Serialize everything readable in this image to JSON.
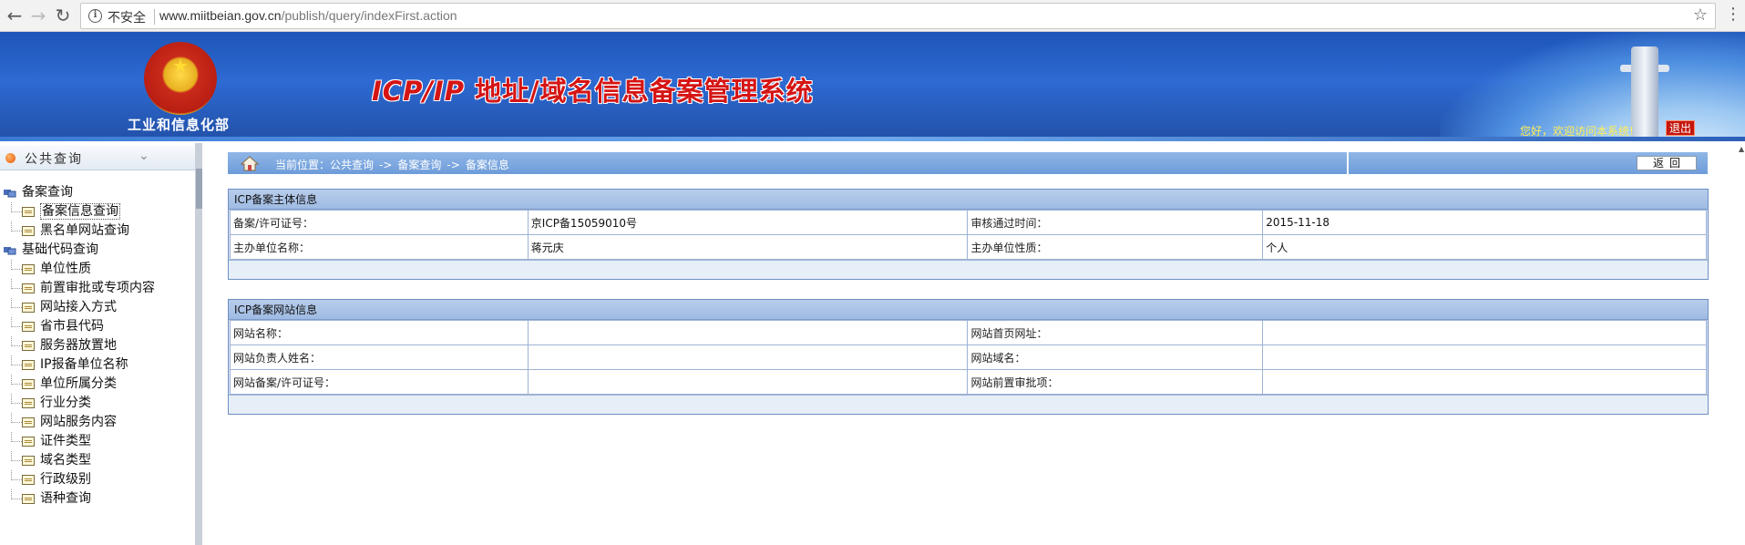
{
  "browser": {
    "security_label": "不安全",
    "url_host": "www.miitbeian.gov.cn",
    "url_path": "/publish/query/indexFirst.action"
  },
  "banner": {
    "ministry": "工业和信息化部",
    "title_latin": "ICP/IP",
    "title_rest": " 地址/域名信息备案管理系统",
    "welcome": "您好，欢迎访问本系统!",
    "logout": "退出"
  },
  "sidebar": {
    "title": "公共查询",
    "groups": [
      {
        "label": "备案查询",
        "items": [
          "备案信息查询",
          "黑名单网站查询"
        ]
      },
      {
        "label": "基础代码查询",
        "items": [
          "单位性质",
          "前置审批或专项内容",
          "网站接入方式",
          "省市县代码",
          "服务器放置地",
          "IP报备单位名称",
          "单位所属分类",
          "行业分类",
          "网站服务内容",
          "证件类型",
          "域名类型",
          "行政级别",
          "语种查询"
        ]
      }
    ]
  },
  "breadcrumb": {
    "prefix": "当前位置：公共查询",
    "sep": "->",
    "step2": "备案查询",
    "step3": "备案信息",
    "back_label": "返回"
  },
  "icp_subject": {
    "title": "ICP备案主体信息",
    "license_label": "备案/许可证号：",
    "license_value": "京ICP备15059010号",
    "approval_label": "审核通过时间：",
    "approval_value": "2015-11-18",
    "sponsor_label": "主办单位名称：",
    "sponsor_value": "蒋元庆",
    "nature_label": "主办单位性质：",
    "nature_value": "个人"
  },
  "icp_site": {
    "title": "ICP备案网站信息",
    "name_label": "网站名称：",
    "name_value": "",
    "homepage_label": "网站首页网址：",
    "homepage_value": "",
    "owner_label": "网站负责人姓名：",
    "owner_value": "",
    "domain_label": "网站域名：",
    "domain_value": "",
    "license_label": "网站备案/许可证号：",
    "license_value": "",
    "preapproval_label": "网站前置审批项：",
    "preapproval_value": ""
  },
  "colors": {
    "banner_blue": "#2d6ad2",
    "title_red": "#d51414",
    "panel_border": "#6e8fc4"
  }
}
